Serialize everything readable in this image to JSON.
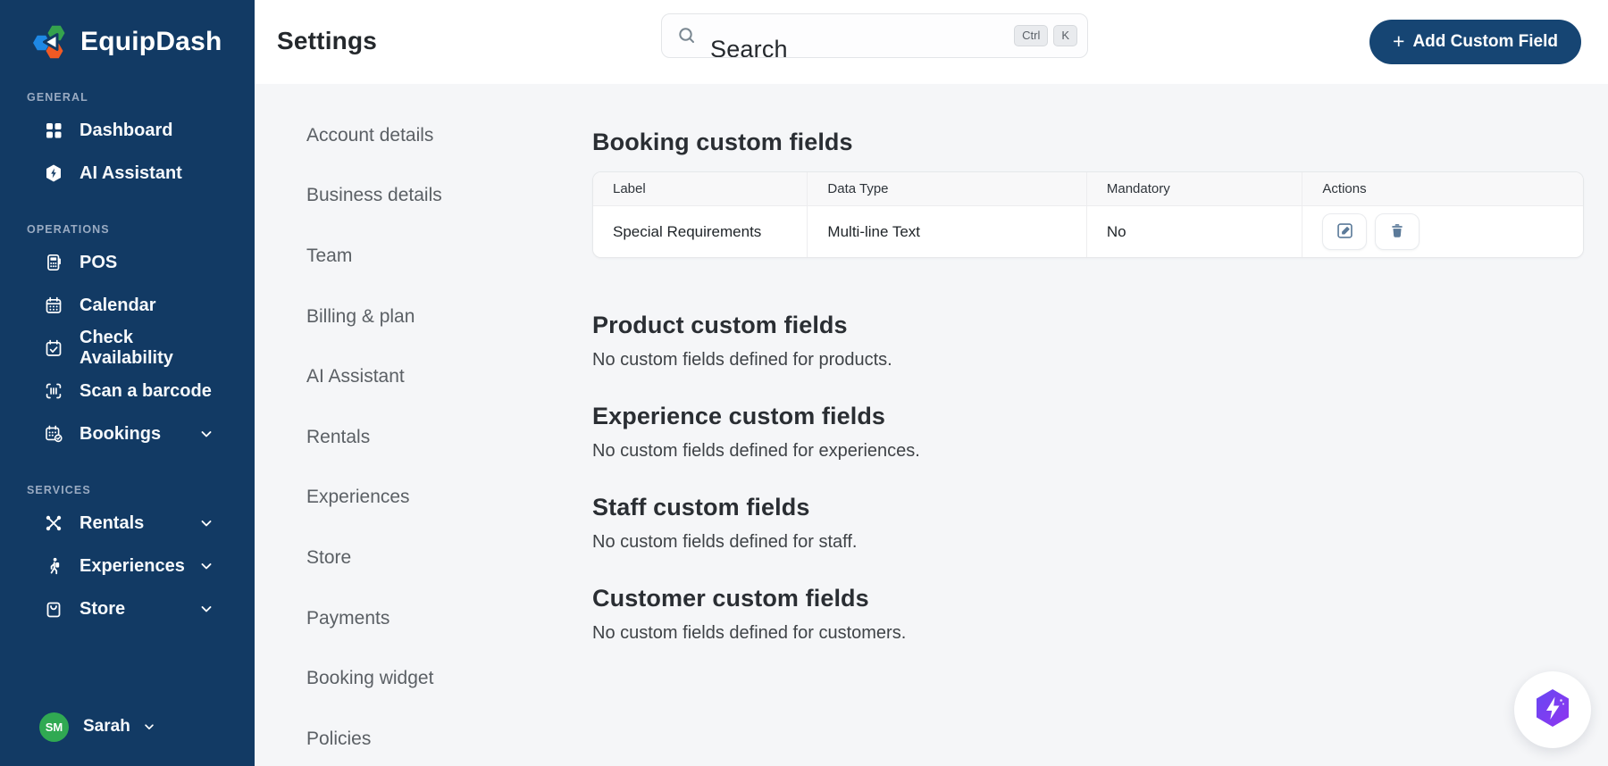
{
  "app": {
    "name": "EquipDash"
  },
  "sidebar": {
    "sections": [
      {
        "label": "GENERAL",
        "items": [
          {
            "label": "Dashboard",
            "icon": "grid-icon"
          },
          {
            "label": "AI Assistant",
            "icon": "ai-hexagon-bolt-icon"
          }
        ]
      },
      {
        "label": "OPERATIONS",
        "items": [
          {
            "label": "POS",
            "icon": "pos-terminal-icon"
          },
          {
            "label": "Calendar",
            "icon": "calendar-icon"
          },
          {
            "label": "Check Availability",
            "icon": "calendar-check-icon"
          },
          {
            "label": "Scan a barcode",
            "icon": "barcode-scan-icon"
          },
          {
            "label": "Bookings",
            "icon": "calendar-badge-check-icon",
            "expandable": true
          }
        ]
      },
      {
        "label": "SERVICES",
        "items": [
          {
            "label": "Rentals",
            "icon": "crossed-paddles-icon",
            "expandable": true
          },
          {
            "label": "Experiences",
            "icon": "hiker-icon",
            "expandable": true
          },
          {
            "label": "Store",
            "icon": "shopping-bag-icon",
            "expandable": true
          }
        ]
      }
    ],
    "user": {
      "initials": "SM",
      "name": "Sarah",
      "avatar_color": "#30a952"
    }
  },
  "header": {
    "title": "Settings",
    "search": {
      "placeholder": "Search",
      "shortcut": [
        "Ctrl",
        "K"
      ]
    },
    "add_button": {
      "plus": "+",
      "label": "Add Custom Field"
    }
  },
  "settings_nav": {
    "items": [
      "Account details",
      "Business details",
      "Team",
      "Billing & plan",
      "AI Assistant",
      "Rentals",
      "Experiences",
      "Store",
      "Payments",
      "Booking widget",
      "Policies"
    ]
  },
  "main": {
    "booking_section": {
      "heading": "Booking custom fields",
      "table": {
        "columns": [
          "Label",
          "Data Type",
          "Mandatory",
          "Actions"
        ],
        "rows": [
          {
            "label": "Special Requirements",
            "data_type": "Multi-line Text",
            "mandatory": "No"
          }
        ]
      }
    },
    "empty_sections": [
      {
        "heading": "Product custom fields",
        "empty_text": "No custom fields defined for products."
      },
      {
        "heading": "Experience custom fields",
        "empty_text": "No custom fields defined for experiences."
      },
      {
        "heading": "Staff custom fields",
        "empty_text": "No custom fields defined for staff."
      },
      {
        "heading": "Customer custom fields",
        "empty_text": "No custom fields defined for customers."
      }
    ]
  },
  "colors": {
    "sidebar_navy": "#123a64",
    "button_navy": "#164573",
    "content_bg": "#f5f6f8",
    "avatar_green": "#30a952",
    "action_icon_slate": "#5b7a99",
    "assistant_purple_start": "#6848f2",
    "assistant_purple_end": "#8f35f0",
    "logo_green": "#35a24d",
    "logo_blue": "#1e88e5",
    "logo_orange": "#f15a24"
  }
}
